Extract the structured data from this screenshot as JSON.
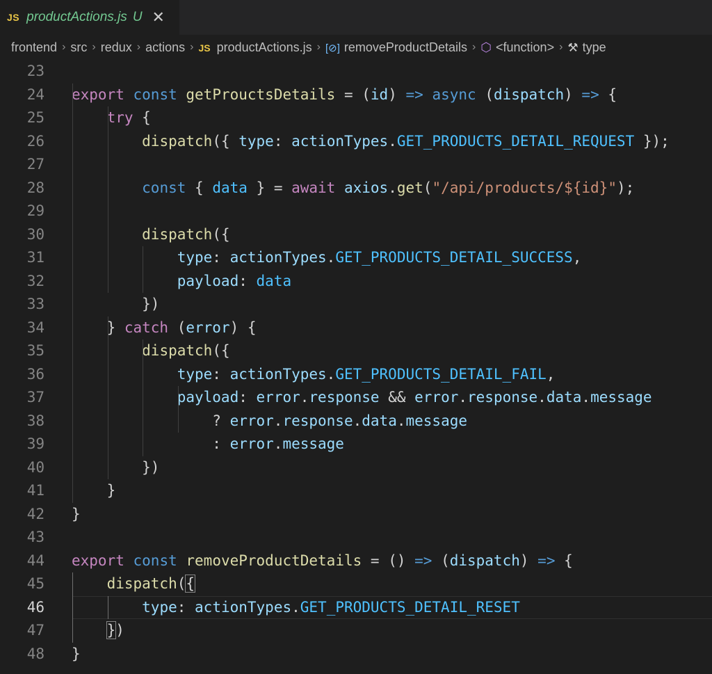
{
  "tab": {
    "badge": "JS",
    "title": "productActions.js",
    "status": "U",
    "close": "✕"
  },
  "breadcrumb": {
    "items": [
      {
        "label": "frontend",
        "icon": ""
      },
      {
        "label": "src",
        "icon": ""
      },
      {
        "label": "redux",
        "icon": ""
      },
      {
        "label": "actions",
        "icon": ""
      },
      {
        "label": "productActions.js",
        "icon": "js-file-icon",
        "badge": "JS"
      },
      {
        "label": "removeProductDetails",
        "icon": "variable-icon",
        "glyph": "[⊘]"
      },
      {
        "label": "<function>",
        "icon": "cube-icon",
        "glyph": "⬡"
      },
      {
        "label": "type",
        "icon": "wrench-icon",
        "glyph": "🔧"
      }
    ],
    "separator": "›"
  },
  "editor": {
    "current_line": 46,
    "lines": [
      {
        "n": "23",
        "tokens": []
      },
      {
        "n": "24",
        "tokens": [
          [
            "kw",
            "export"
          ],
          [
            "txt",
            " "
          ],
          [
            "st",
            "const"
          ],
          [
            "txt",
            " "
          ],
          [
            "fn",
            "getProuctsDetails"
          ],
          [
            "txt",
            " = ("
          ],
          [
            "var",
            "id"
          ],
          [
            "txt",
            ") "
          ],
          [
            "st",
            "=>"
          ],
          [
            "txt",
            " "
          ],
          [
            "st",
            "async"
          ],
          [
            "txt",
            " ("
          ],
          [
            "var",
            "dispatch"
          ],
          [
            "txt",
            ") "
          ],
          [
            "st",
            "=>"
          ],
          [
            "txt",
            " {"
          ]
        ]
      },
      {
        "n": "25",
        "tokens": [
          [
            "txt",
            "    "
          ],
          [
            "kw",
            "try"
          ],
          [
            "txt",
            " {"
          ]
        ]
      },
      {
        "n": "26",
        "tokens": [
          [
            "txt",
            "        "
          ],
          [
            "fn",
            "dispatch"
          ],
          [
            "txt",
            "({ "
          ],
          [
            "var",
            "type"
          ],
          [
            "txt",
            ": "
          ],
          [
            "var",
            "actionTypes"
          ],
          [
            "txt",
            "."
          ],
          [
            "const",
            "GET_PRODUCTS_DETAIL_REQUEST"
          ],
          [
            "txt",
            " });"
          ]
        ]
      },
      {
        "n": "27",
        "tokens": []
      },
      {
        "n": "28",
        "tokens": [
          [
            "txt",
            "        "
          ],
          [
            "st",
            "const"
          ],
          [
            "txt",
            " { "
          ],
          [
            "const",
            "data"
          ],
          [
            "txt",
            " } = "
          ],
          [
            "kw",
            "await"
          ],
          [
            "txt",
            " "
          ],
          [
            "var",
            "axios"
          ],
          [
            "txt",
            "."
          ],
          [
            "fn",
            "get"
          ],
          [
            "txt",
            "("
          ],
          [
            "str",
            "\"/api/products/${id}\""
          ],
          [
            "txt",
            ");"
          ]
        ]
      },
      {
        "n": "29",
        "tokens": []
      },
      {
        "n": "30",
        "tokens": [
          [
            "txt",
            "        "
          ],
          [
            "fn",
            "dispatch"
          ],
          [
            "txt",
            "({"
          ]
        ]
      },
      {
        "n": "31",
        "tokens": [
          [
            "txt",
            "            "
          ],
          [
            "var",
            "type"
          ],
          [
            "txt",
            ": "
          ],
          [
            "var",
            "actionTypes"
          ],
          [
            "txt",
            "."
          ],
          [
            "const",
            "GET_PRODUCTS_DETAIL_SUCCESS"
          ],
          [
            "txt",
            ","
          ]
        ]
      },
      {
        "n": "32",
        "tokens": [
          [
            "txt",
            "            "
          ],
          [
            "var",
            "payload"
          ],
          [
            "txt",
            ": "
          ],
          [
            "const",
            "data"
          ]
        ]
      },
      {
        "n": "33",
        "tokens": [
          [
            "txt",
            "        })"
          ]
        ]
      },
      {
        "n": "34",
        "tokens": [
          [
            "txt",
            "    } "
          ],
          [
            "kw",
            "catch"
          ],
          [
            "txt",
            " ("
          ],
          [
            "var",
            "error"
          ],
          [
            "txt",
            ") {"
          ]
        ]
      },
      {
        "n": "35",
        "tokens": [
          [
            "txt",
            "        "
          ],
          [
            "fn",
            "dispatch"
          ],
          [
            "txt",
            "({"
          ]
        ]
      },
      {
        "n": "36",
        "tokens": [
          [
            "txt",
            "            "
          ],
          [
            "var",
            "type"
          ],
          [
            "txt",
            ": "
          ],
          [
            "var",
            "actionTypes"
          ],
          [
            "txt",
            "."
          ],
          [
            "const",
            "GET_PRODUCTS_DETAIL_FAIL"
          ],
          [
            "txt",
            ","
          ]
        ]
      },
      {
        "n": "37",
        "tokens": [
          [
            "txt",
            "            "
          ],
          [
            "var",
            "payload"
          ],
          [
            "txt",
            ": "
          ],
          [
            "var",
            "error"
          ],
          [
            "txt",
            "."
          ],
          [
            "var",
            "response"
          ],
          [
            "txt",
            " && "
          ],
          [
            "var",
            "error"
          ],
          [
            "txt",
            "."
          ],
          [
            "var",
            "response"
          ],
          [
            "txt",
            "."
          ],
          [
            "var",
            "data"
          ],
          [
            "txt",
            "."
          ],
          [
            "var",
            "message"
          ]
        ]
      },
      {
        "n": "38",
        "tokens": [
          [
            "txt",
            "                ? "
          ],
          [
            "var",
            "error"
          ],
          [
            "txt",
            "."
          ],
          [
            "var",
            "response"
          ],
          [
            "txt",
            "."
          ],
          [
            "var",
            "data"
          ],
          [
            "txt",
            "."
          ],
          [
            "var",
            "message"
          ]
        ]
      },
      {
        "n": "39",
        "tokens": [
          [
            "txt",
            "                : "
          ],
          [
            "var",
            "error"
          ],
          [
            "txt",
            "."
          ],
          [
            "var",
            "message"
          ]
        ]
      },
      {
        "n": "40",
        "tokens": [
          [
            "txt",
            "        })"
          ]
        ]
      },
      {
        "n": "41",
        "tokens": [
          [
            "txt",
            "    }"
          ]
        ]
      },
      {
        "n": "42",
        "tokens": [
          [
            "txt",
            "}"
          ]
        ]
      },
      {
        "n": "43",
        "tokens": []
      },
      {
        "n": "44",
        "tokens": [
          [
            "kw",
            "export"
          ],
          [
            "txt",
            " "
          ],
          [
            "st",
            "const"
          ],
          [
            "txt",
            " "
          ],
          [
            "fn",
            "removeProductDetails"
          ],
          [
            "txt",
            " = () "
          ],
          [
            "st",
            "=>"
          ],
          [
            "txt",
            " ("
          ],
          [
            "var",
            "dispatch"
          ],
          [
            "txt",
            ") "
          ],
          [
            "st",
            "=>"
          ],
          [
            "txt",
            " {"
          ]
        ]
      },
      {
        "n": "45",
        "tokens": [
          [
            "txt",
            "    "
          ],
          [
            "fn",
            "dispatch"
          ],
          [
            "txt",
            "("
          ],
          [
            "box",
            "{"
          ]
        ]
      },
      {
        "n": "46",
        "tokens": [
          [
            "txt",
            "        "
          ],
          [
            "var",
            "type"
          ],
          [
            "txt",
            ": "
          ],
          [
            "var",
            "actionTypes"
          ],
          [
            "txt",
            "."
          ],
          [
            "const",
            "GET_PRODUCTS_DETAIL_RESET"
          ]
        ]
      },
      {
        "n": "47",
        "tokens": [
          [
            "txt",
            "    "
          ],
          [
            "box",
            "}"
          ],
          [
            "txt",
            ")"
          ]
        ]
      },
      {
        "n": "48",
        "tokens": [
          [
            "txt",
            "}"
          ]
        ]
      }
    ]
  }
}
